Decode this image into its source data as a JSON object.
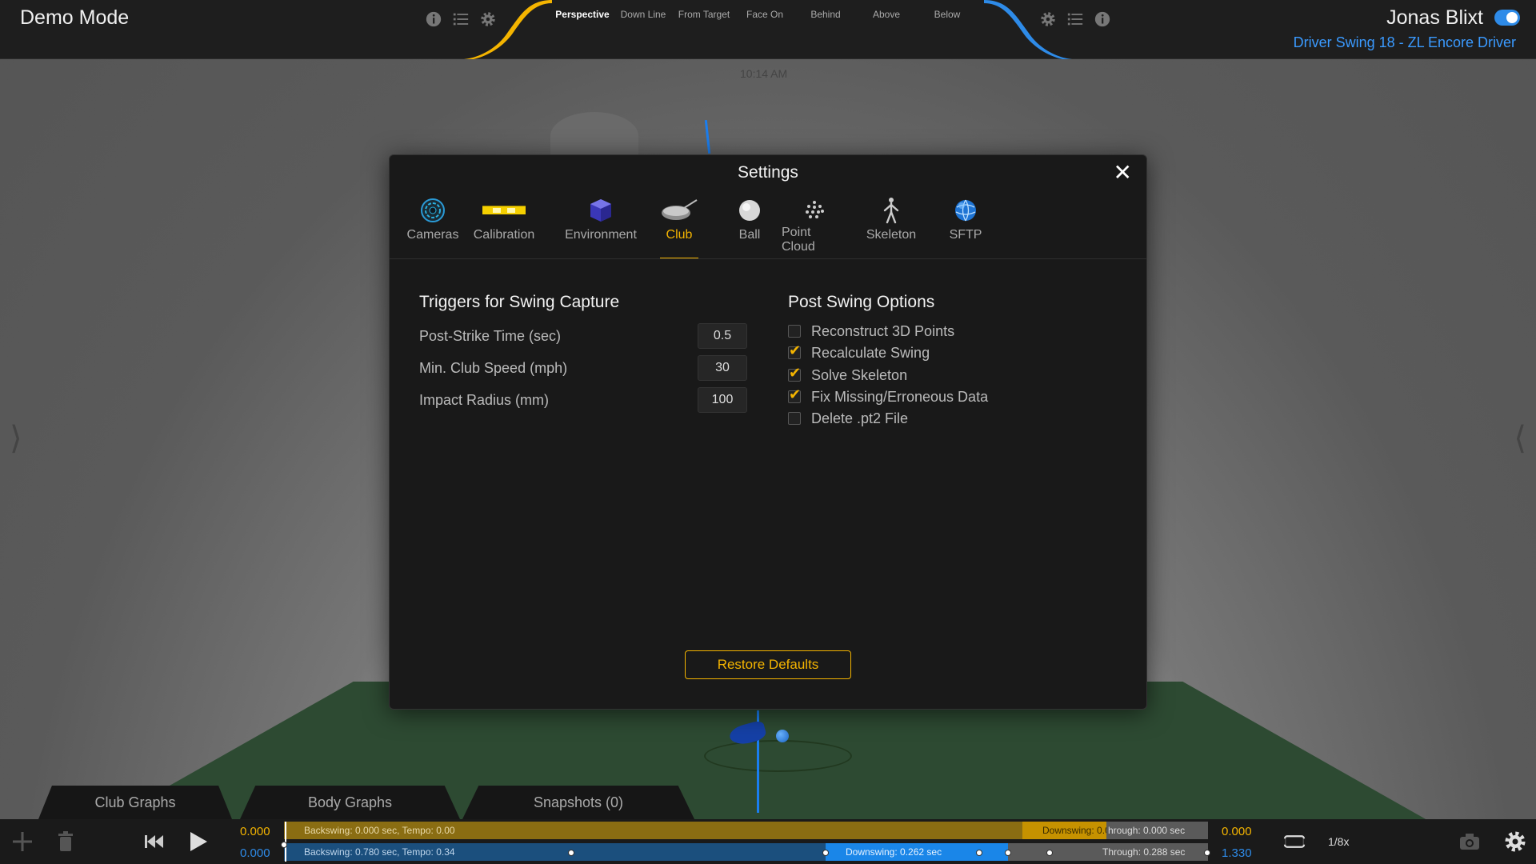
{
  "header": {
    "mode_title": "Demo Mode",
    "view_tabs": [
      "Perspective",
      "Down Line",
      "From Target",
      "Face On",
      "Behind",
      "Above",
      "Below"
    ],
    "active_view": "Perspective",
    "user_name": "Jonas Blixt",
    "swing_name": "Driver Swing 18 - ZL Encore Driver",
    "icons_left": [
      "info-icon",
      "list-icon",
      "gear-icon"
    ],
    "icons_right": [
      "gear-icon",
      "list-icon",
      "info-icon"
    ],
    "accent_left": "#f4b400",
    "accent_right": "#2e8be8"
  },
  "scene": {
    "clock": "10:14 AM"
  },
  "settings": {
    "title": "Settings",
    "tabs": [
      {
        "label": "Cameras",
        "icon": "camera-lens-icon"
      },
      {
        "label": "Calibration",
        "icon": "calibration-bar-icon"
      },
      {
        "label": "Environment",
        "icon": "cube-icon"
      },
      {
        "label": "Club",
        "icon": "driver-club-icon"
      },
      {
        "label": "Ball",
        "icon": "ball-icon"
      },
      {
        "label": "Point Cloud",
        "icon": "point-cloud-icon"
      },
      {
        "label": "Skeleton",
        "icon": "skeleton-icon"
      },
      {
        "label": "SFTP",
        "icon": "globe-icon"
      }
    ],
    "active_tab": "Club",
    "triggers": {
      "title": "Triggers for Swing Capture",
      "fields": [
        {
          "label": "Post-Strike Time (sec)",
          "value": "0.5"
        },
        {
          "label": "Min. Club Speed (mph)",
          "value": "30"
        },
        {
          "label": "Impact Radius (mm)",
          "value": "100"
        }
      ]
    },
    "post_swing": {
      "title": "Post Swing Options",
      "options": [
        {
          "label": "Reconstruct 3D Points",
          "checked": false
        },
        {
          "label": "Recalculate Swing",
          "checked": true
        },
        {
          "label": "Solve Skeleton",
          "checked": true
        },
        {
          "label": "Fix Missing/Erroneous Data",
          "checked": true
        },
        {
          "label": "Delete .pt2 File",
          "checked": false
        }
      ]
    },
    "restore_label": "Restore Defaults"
  },
  "graph_tabs": [
    "Club Graphs",
    "Body Graphs",
    "Snapshots (0)"
  ],
  "timeline": {
    "top": {
      "start": "0.000",
      "end": "0.000",
      "backswing": "Backswing: 0.000 sec, Tempo: 0.00",
      "downswing": "Downswing: 0.0",
      "through": "hrough: 0.000 sec",
      "color": "#f4b400"
    },
    "bottom": {
      "start": "0.000",
      "end": "1.330",
      "backswing": "Backswing: 0.780 sec, Tempo: 0.34",
      "downswing": "Downswing: 0.262 sec",
      "through": "Through: 0.288 sec",
      "color": "#2e8be8"
    },
    "speed": "1/8x"
  }
}
